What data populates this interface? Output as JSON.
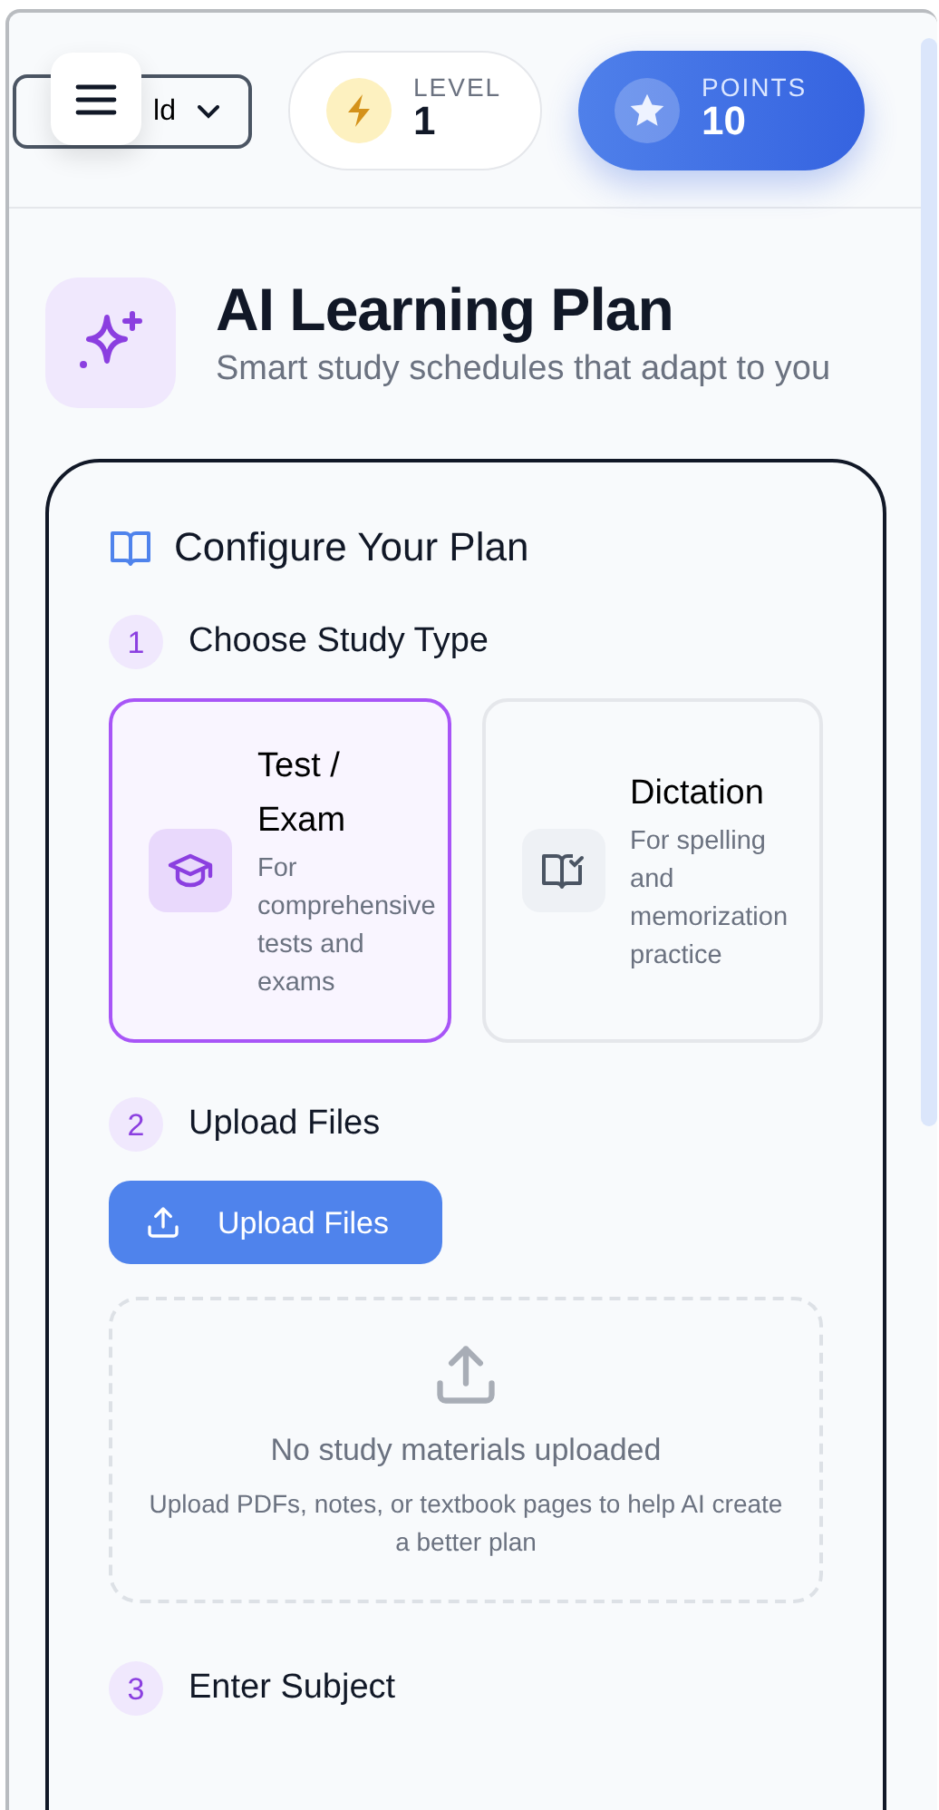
{
  "header": {
    "dropdown": {
      "label": "ld"
    },
    "level": {
      "label": "LEVEL",
      "value": "1"
    },
    "points": {
      "label": "POINTS",
      "value": "10"
    }
  },
  "title": "AI Learning Plan",
  "subtitle": "Smart study schedules that adapt to you",
  "panel": {
    "title": "Configure Your Plan",
    "steps": [
      {
        "number": "1",
        "label": "Choose Study Type"
      },
      {
        "number": "2",
        "label": "Upload Files"
      },
      {
        "number": "3",
        "label": "Enter Subject"
      }
    ],
    "study_types": [
      {
        "kind": "exam",
        "title": "Test / Exam",
        "description": "For comprehensive tests and exams",
        "selected": true
      },
      {
        "kind": "dictation",
        "title": "Dictation",
        "description": "For spelling and memorization practice",
        "selected": false
      }
    ],
    "upload_button": "Upload Files",
    "dropzone": {
      "title": "No study materials uploaded",
      "hint": "Upload PDFs, notes, or textbook pages to help AI create a better plan"
    }
  }
}
